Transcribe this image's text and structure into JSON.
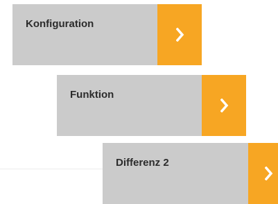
{
  "nav": {
    "items": [
      {
        "label": "Konfiguration",
        "icon": "chevron-right-icon"
      },
      {
        "label": "Funktion",
        "icon": "chevron-right-icon"
      },
      {
        "label": "Differenz 2",
        "icon": "chevron-right-icon"
      }
    ]
  },
  "colors": {
    "tile_background": "#cbcbcb",
    "accent": "#f7a623",
    "label_text": "#2c2c2c",
    "icon": "#ffffff"
  }
}
